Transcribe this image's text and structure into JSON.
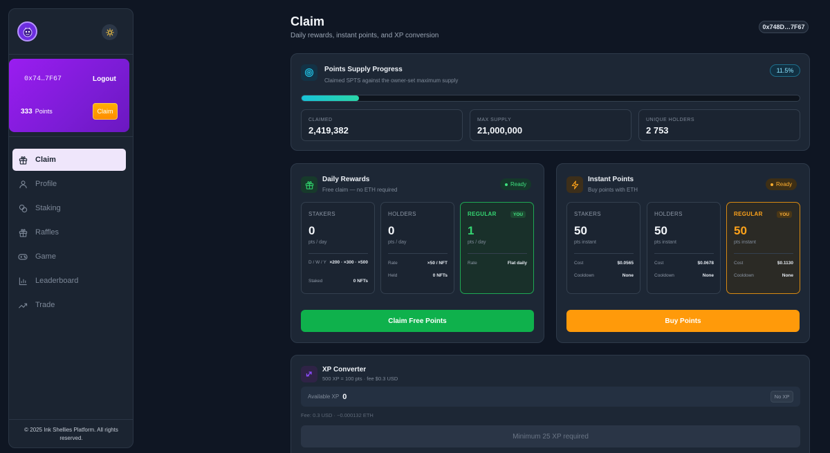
{
  "sidebar": {
    "user": {
      "address": "0x74…7F67",
      "logout_label": "Logout",
      "points": "333",
      "points_label": "Points",
      "claim_label": "Claim"
    },
    "nav": [
      {
        "label": "Claim",
        "icon": "gift-icon",
        "active": true
      },
      {
        "label": "Profile",
        "icon": "user-icon"
      },
      {
        "label": "Staking",
        "icon": "coins-icon"
      },
      {
        "label": "Raffles",
        "icon": "gift-icon"
      },
      {
        "label": "Game",
        "icon": "gamepad-icon"
      },
      {
        "label": "Leaderboard",
        "icon": "bar-chart-icon"
      },
      {
        "label": "Trade",
        "icon": "trending-up-icon"
      }
    ],
    "footer": "© 2025 Ink Shellies Platform. All rights reserved."
  },
  "header": {
    "title": "Claim",
    "subtitle": "Daily rewards, instant points, and XP conversion",
    "wallet": "0x748D…7F67"
  },
  "supply": {
    "title": "Points Supply Progress",
    "subtitle": "Claimed SPTS against the owner-set maximum supply",
    "percent_label": "11.5%",
    "progress": 0.115,
    "stats": [
      {
        "label": "CLAIMED",
        "value": "2,419,382"
      },
      {
        "label": "MAX SUPPLY",
        "value": "21,000,000"
      },
      {
        "label": "UNIQUE HOLDERS",
        "value": "2 753"
      }
    ]
  },
  "daily": {
    "title": "Daily Rewards",
    "subtitle": "Free claim — no ETH required",
    "status": "Ready",
    "tiers": [
      {
        "name": "STAKERS",
        "value": "0",
        "unit": "pts / day",
        "rows": [
          {
            "k": "D / W / Y",
            "v": "×200 · ×300 · ×500"
          },
          {
            "k": "Staked",
            "v": "0 NFTs"
          }
        ]
      },
      {
        "name": "HOLDERS",
        "value": "0",
        "unit": "pts / day",
        "rows": [
          {
            "k": "Rate",
            "v": "×50 / NFT"
          },
          {
            "k": "Held",
            "v": "0 NFTs"
          }
        ]
      },
      {
        "name": "REGULAR",
        "value": "1",
        "unit": "pts / day",
        "you": "YOU",
        "rows": [
          {
            "k": "Rate",
            "v": "Flat daily"
          }
        ]
      }
    ],
    "cta": "Claim Free Points",
    "accent": "#1fc15a"
  },
  "instant": {
    "title": "Instant Points",
    "subtitle": "Buy points with ETH",
    "status": "Ready",
    "tiers": [
      {
        "name": "STAKERS",
        "value": "50",
        "unit": "pts instant",
        "rows": [
          {
            "k": "Cost",
            "v": "$0.0565"
          },
          {
            "k": "Cooldown",
            "v": "None"
          }
        ]
      },
      {
        "name": "HOLDERS",
        "value": "50",
        "unit": "pts instant",
        "rows": [
          {
            "k": "Cost",
            "v": "$0.0678"
          },
          {
            "k": "Cooldown",
            "v": "None"
          }
        ]
      },
      {
        "name": "REGULAR",
        "value": "50",
        "unit": "pts instant",
        "you": "YOU",
        "rows": [
          {
            "k": "Cost",
            "v": "$0.1130"
          },
          {
            "k": "Cooldown",
            "v": "None"
          }
        ]
      }
    ],
    "cta": "Buy Points",
    "accent": "#ff9a0a"
  },
  "xp": {
    "title": "XP Converter",
    "subtitle": "500 XP = 100 pts · fee $0.3 USD",
    "available_label": "Available XP",
    "available_value": "0",
    "no_xp_label": "No XP",
    "fee_text": "Fee: 0.3 USD · ~0.000132 ETH",
    "button": "Minimum 25 XP required"
  }
}
